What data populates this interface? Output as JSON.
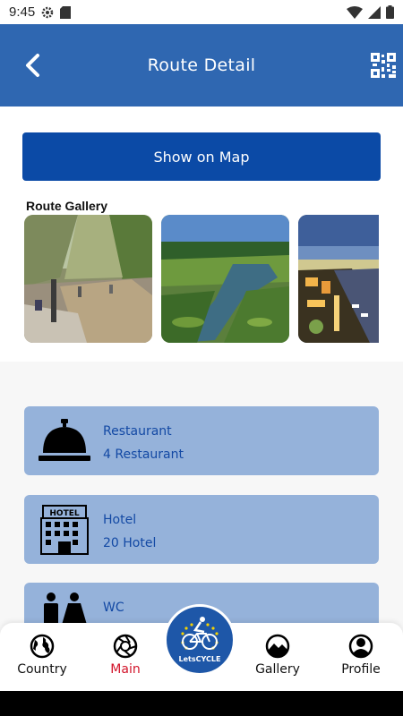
{
  "status_bar": {
    "time": "9:45"
  },
  "header": {
    "title": "Route Detail"
  },
  "main": {
    "show_map_label": "Show on Map",
    "gallery_title": "Route Gallery",
    "gallery_images": [
      "river-canyon-photo",
      "green-wetland-photo",
      "night-coastal-city-photo"
    ],
    "cards": [
      {
        "icon": "service-bell-icon",
        "title": "Restaurant",
        "subtitle": "4 Restaurant"
      },
      {
        "icon": "hotel-building-icon",
        "title": "Hotel",
        "subtitle": "20 Hotel"
      },
      {
        "icon": "wc-people-icon",
        "title": "WC",
        "subtitle": ""
      }
    ]
  },
  "bottom_nav": {
    "items": [
      {
        "label": "Country",
        "icon": "globe-icon"
      },
      {
        "label": "Main",
        "icon": "aperture-icon",
        "active": true
      },
      {
        "label": "Gallery",
        "icon": "mountain-icon"
      },
      {
        "label": "Profile",
        "icon": "person-icon"
      }
    ],
    "logo_text": "LetsCYCLE"
  },
  "colors": {
    "app_bar": "#2f67b1",
    "primary_button": "#0b4aa6",
    "card_bg": "#95b2da",
    "card_text": "#1349a4",
    "active_nav": "#d2142a"
  }
}
